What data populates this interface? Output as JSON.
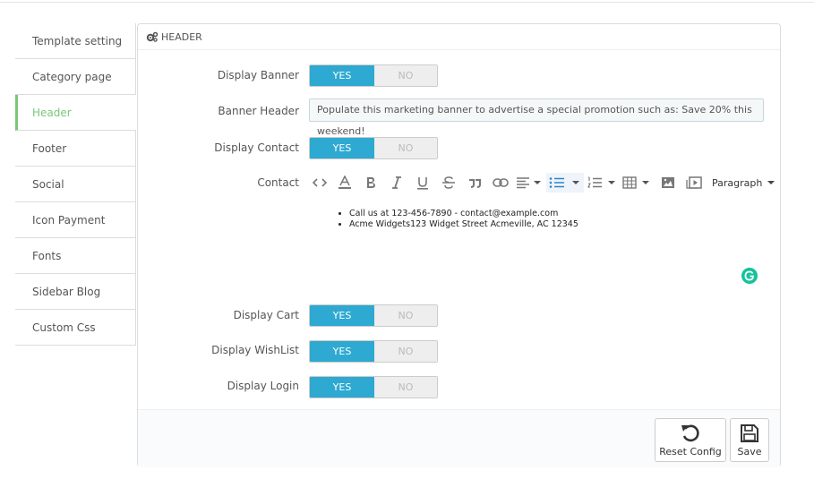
{
  "sidebar": {
    "items": [
      {
        "label": "Template setting",
        "active": false
      },
      {
        "label": "Category page",
        "active": false
      },
      {
        "label": "Header",
        "active": true
      },
      {
        "label": "Footer",
        "active": false
      },
      {
        "label": "Social",
        "active": false
      },
      {
        "label": "Icon Payment",
        "active": false
      },
      {
        "label": "Fonts",
        "active": false
      },
      {
        "label": "Sidebar Blog",
        "active": false
      },
      {
        "label": "Custom Css",
        "active": false
      }
    ],
    "active_color": "#7cc67c"
  },
  "panel": {
    "title": "HEADER",
    "fields": {
      "display_banner": {
        "label": "Display Banner",
        "yes": "YES",
        "no": "NO",
        "value": "YES"
      },
      "banner_header": {
        "label": "Banner Header",
        "value": "Populate this marketing banner to advertise a special promotion such as: Save 20% this weekend!"
      },
      "display_contact": {
        "label": "Display Contact",
        "yes": "YES",
        "no": "NO",
        "value": "YES"
      },
      "contact": {
        "label": "Contact",
        "toolbar_format": "Paragraph",
        "items": [
          "Call us at 123-456-7890 - contact@example.com",
          "Acme Widgets123 Widget Street Acmeville, AC 12345"
        ]
      },
      "display_cart": {
        "label": "Display Cart",
        "yes": "YES",
        "no": "NO",
        "value": "YES"
      },
      "display_wishlist": {
        "label": "Display WishList",
        "yes": "YES",
        "no": "NO",
        "value": "YES"
      },
      "display_login": {
        "label": "Display Login",
        "yes": "YES",
        "no": "NO",
        "value": "YES"
      }
    },
    "footer": {
      "reset_label": "Reset Config",
      "save_label": "Save"
    }
  },
  "colors": {
    "toggle_yes": "#2ea9d1",
    "grammarly": "#15c39a"
  }
}
